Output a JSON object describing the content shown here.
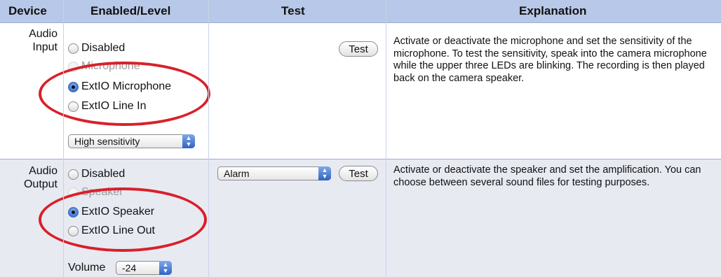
{
  "header": {
    "device": "Device",
    "enabled_level": "Enabled/Level",
    "test": "Test",
    "explanation": "Explanation"
  },
  "audio_input": {
    "device_label_line1": "Audio",
    "device_label_line2": "Input",
    "options": [
      {
        "label": "Disabled",
        "selected": false
      },
      {
        "label": "Microphone",
        "selected": false
      },
      {
        "label": "ExtIO Microphone",
        "selected": true
      },
      {
        "label": "ExtIO Line In",
        "selected": false
      }
    ],
    "sensitivity_select": "High sensitivity",
    "test_button": "Test",
    "explanation": "Activate or deactivate the microphone and set the sensitivity of the microphone. To test the sensitivity, speak into the camera microphone while the upper three LEDs are blinking. The recording is then played back on the camera speaker."
  },
  "audio_output": {
    "device_label_line1": "Audio",
    "device_label_line2": "Output",
    "options": [
      {
        "label": "Disabled",
        "selected": false
      },
      {
        "label": "Speaker",
        "selected": false
      },
      {
        "label": "ExtIO Speaker",
        "selected": true
      },
      {
        "label": "ExtIO Line Out",
        "selected": false
      }
    ],
    "volume_label": "Volume",
    "volume_value": "-24",
    "sound_select": "Alarm",
    "test_button": "Test",
    "explanation": "Activate or deactivate the speaker and set the amplification. You can choose between several sound files for testing purposes."
  },
  "colors": {
    "header_bg": "#b8c8e8",
    "row_alt_bg": "#e8eaf2",
    "highlight_ellipse": "#d8202a",
    "radio_selected": "#3a74d2"
  }
}
